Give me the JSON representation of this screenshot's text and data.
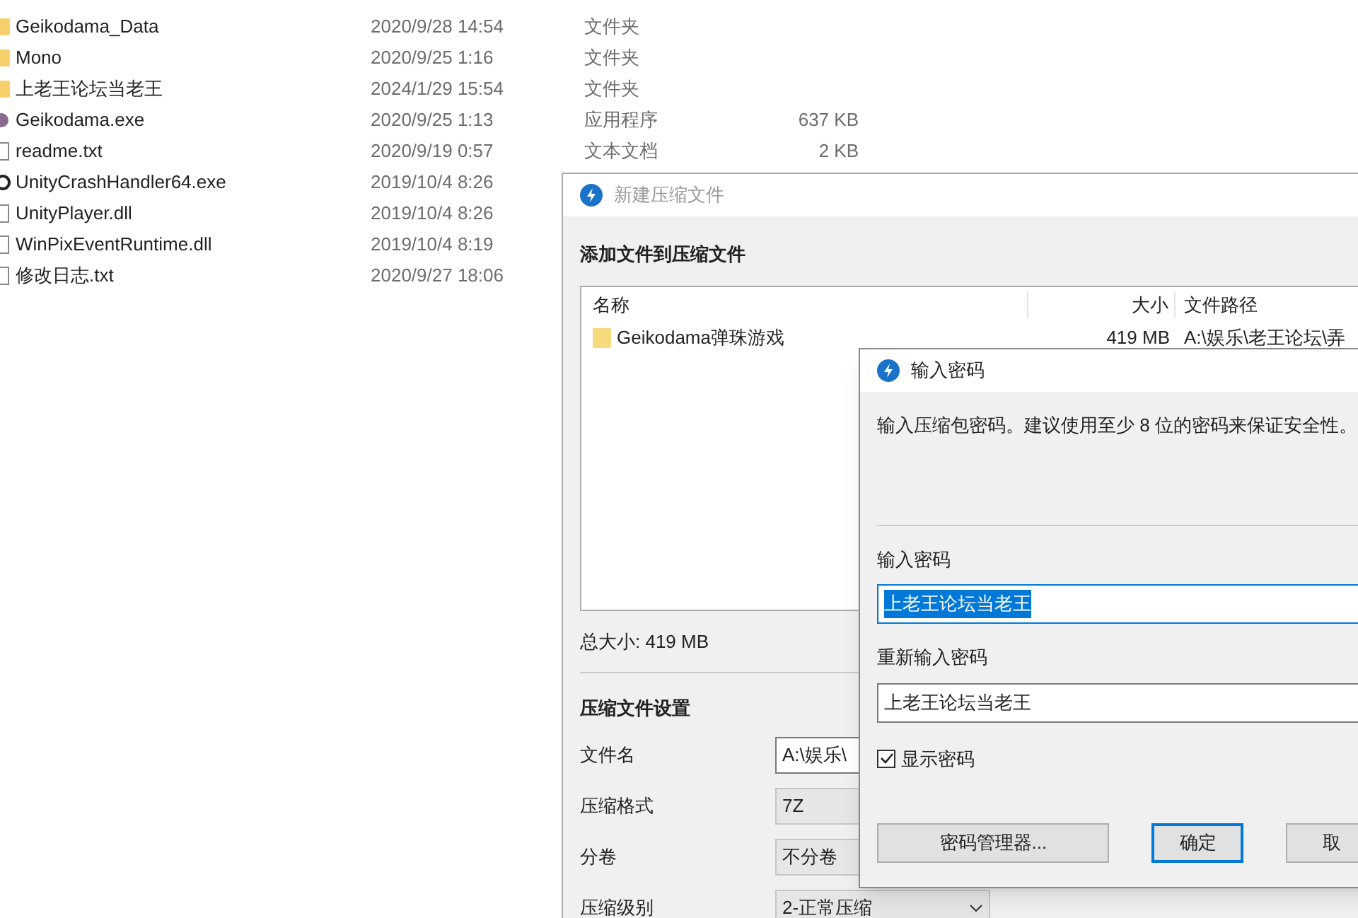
{
  "files": [
    {
      "kind": "folder",
      "name": "Geikodama_Data",
      "date": "2020/9/28 14:54",
      "type": "文件夹"
    },
    {
      "kind": "folder",
      "name": "Mono",
      "date": "2020/9/25 1:16",
      "type": "文件夹"
    },
    {
      "kind": "folder",
      "name": "上老王论坛当老王",
      "date": "2024/1/29 15:54",
      "type": "文件夹"
    },
    {
      "kind": "app",
      "name": "Geikodama.exe",
      "date": "2020/9/25 1:13",
      "type": "应用程序",
      "size": "637 KB"
    },
    {
      "kind": "text",
      "name": "readme.txt",
      "date": "2020/9/19 0:57",
      "type": "文本文档",
      "size": "2 KB"
    },
    {
      "kind": "unity",
      "name": "UnityCrashHandler64.exe",
      "date": "2019/10/4 8:26"
    },
    {
      "kind": "text",
      "name": "UnityPlayer.dll",
      "date": "2019/10/4 8:26"
    },
    {
      "kind": "text",
      "name": "WinPixEventRuntime.dll",
      "date": "2019/10/4 8:19"
    },
    {
      "kind": "text",
      "name": "修改日志.txt",
      "date": "2020/9/27 18:06"
    }
  ],
  "archive_dialog": {
    "title": "新建压缩文件",
    "active": false,
    "heading": "添加文件到压缩文件",
    "columns": [
      "名称",
      "大小",
      "文件路径"
    ],
    "rows": [
      {
        "name": "Geikodama弹珠游戏",
        "size": "419 MB",
        "path": "A:\\娱乐\\老王论坛\\弄"
      }
    ],
    "total": "总大小: 419 MB",
    "settings_heading": "压缩文件设置",
    "settings": [
      {
        "kind": "text",
        "label": "文件名",
        "value": "A:\\娱乐\\"
      },
      {
        "kind": "readonly",
        "label": "压缩格式",
        "value": "7Z"
      },
      {
        "kind": "readonly",
        "label": "分卷",
        "value": "不分卷"
      },
      {
        "kind": "dropdown",
        "label": "压缩级别",
        "value": "2-正常压缩"
      }
    ]
  },
  "password_dialog": {
    "title": "输入密码",
    "active": true,
    "message": "输入压缩包密码。建议使用至少 8 位的密码来保证安全性。",
    "fields": [
      {
        "label": "输入密码",
        "value": "上老王论坛当老王",
        "selected": true
      },
      {
        "label": "重新输入密码",
        "value": "上老王论坛当老王",
        "selected": false
      }
    ],
    "show_password": {
      "label": "显示密码",
      "checked": true
    },
    "buttons": [
      {
        "label": "密码管理器...",
        "default": false
      },
      {
        "label": "确定",
        "default": true
      },
      {
        "label": "取",
        "default": false
      }
    ]
  }
}
